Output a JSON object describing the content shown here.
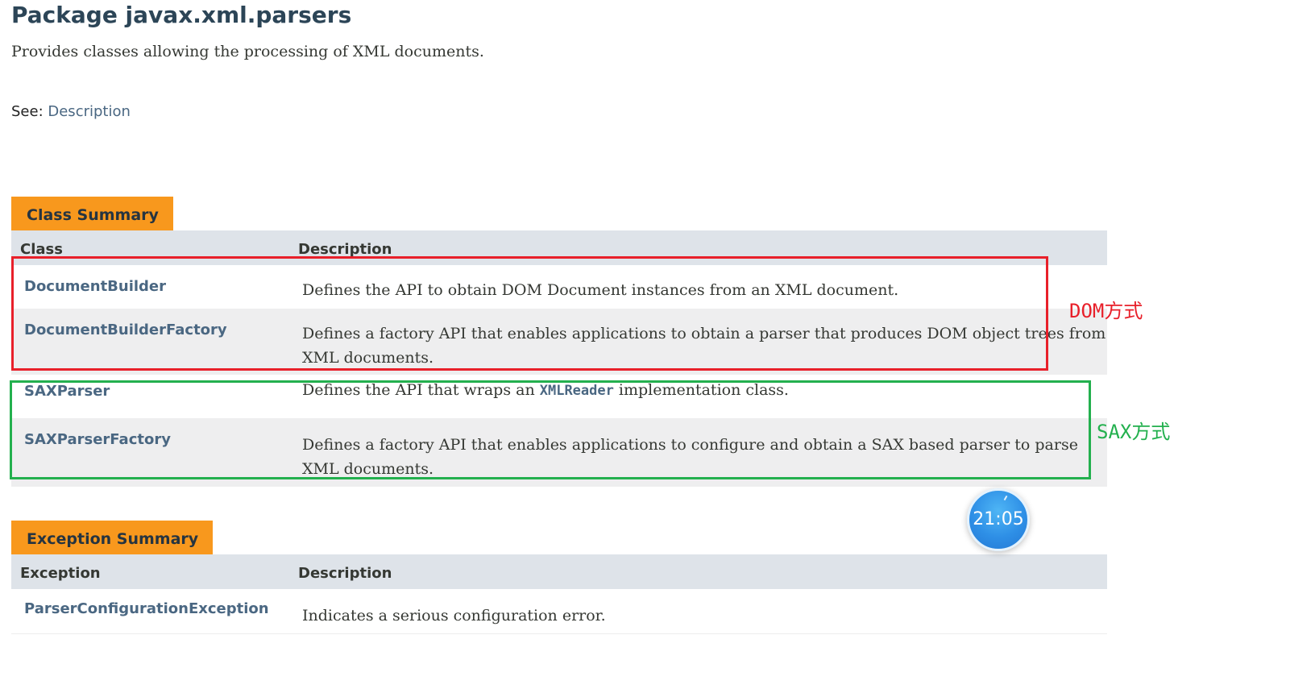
{
  "page": {
    "title": "Package javax.xml.parsers",
    "description": "Provides classes allowing the processing of XML documents.",
    "see_label": "See:",
    "see_link": "Description"
  },
  "class_summary": {
    "tab_label": "Class Summary",
    "columns": [
      "Class",
      "Description"
    ],
    "rows": [
      {
        "name": "DocumentBuilder",
        "description": "Defines the API to obtain DOM Document instances from an XML document."
      },
      {
        "name": "DocumentBuilderFactory",
        "description": "Defines a factory API that enables applications to obtain a parser that produces DOM object trees from XML documents."
      },
      {
        "name": "SAXParser",
        "description_before": "Defines the API that wraps an ",
        "description_code": "XMLReader",
        "description_after": " implementation class."
      },
      {
        "name": "SAXParserFactory",
        "description": "Defines a factory API that enables applications to configure and obtain a SAX based parser to parse XML documents."
      }
    ]
  },
  "exception_summary": {
    "tab_label": "Exception Summary",
    "columns": [
      "Exception",
      "Description"
    ],
    "rows": [
      {
        "name": "ParserConfigurationException",
        "description": "Indicates a serious configuration error."
      }
    ]
  },
  "annotations": {
    "dom_label": "DOM方式",
    "sax_label": "SAX方式",
    "dom_color": "#e8202a",
    "sax_color": "#23b04e"
  },
  "clock_widget": {
    "time": "21:05"
  },
  "colors": {
    "tab_orange": "#f8981d",
    "header_gray": "#dee3e9",
    "link_blue": "#4a6782",
    "title_color": "#2c4557"
  }
}
